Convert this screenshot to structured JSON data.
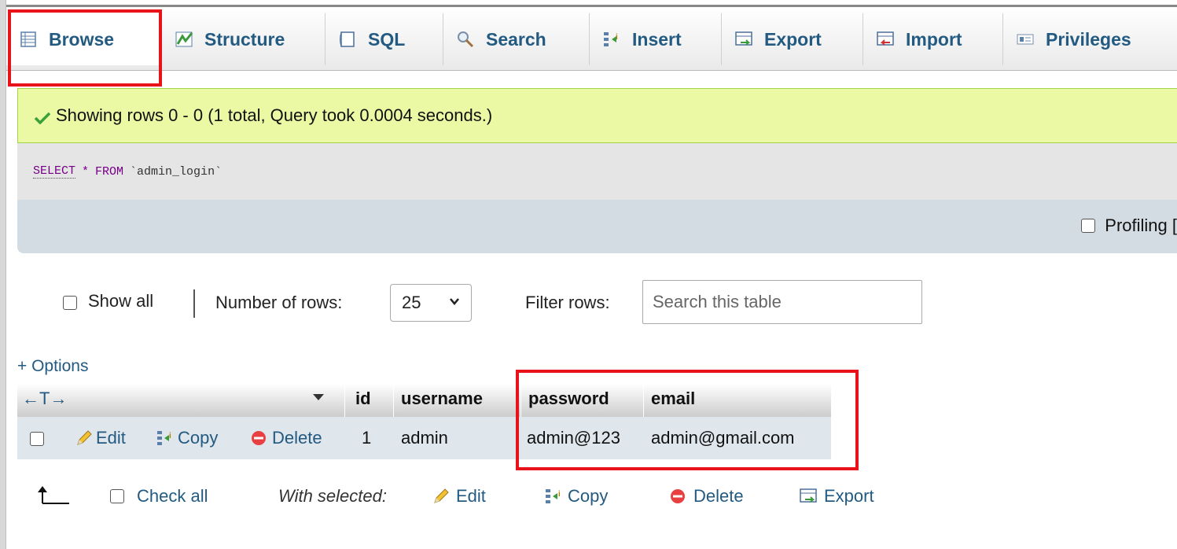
{
  "tabs": [
    {
      "label": "Browse",
      "icon": "browse-icon"
    },
    {
      "label": "Structure",
      "icon": "structure-icon"
    },
    {
      "label": "SQL",
      "icon": "sql-icon"
    },
    {
      "label": "Search",
      "icon": "search-icon"
    },
    {
      "label": "Insert",
      "icon": "insert-icon"
    },
    {
      "label": "Export",
      "icon": "export-icon"
    },
    {
      "label": "Import",
      "icon": "import-icon"
    },
    {
      "label": "Privileges",
      "icon": "privileges-icon"
    }
  ],
  "message": {
    "text": "Showing rows 0 - 0 (1 total, Query took 0.0004 seconds.)"
  },
  "sql": {
    "select": "SELECT",
    "star": "*",
    "from": "FROM",
    "table": "`admin_login`"
  },
  "profiling": {
    "label": "Profiling ["
  },
  "controls": {
    "show_all": "Show all",
    "num_rows_label": "Number of rows:",
    "num_rows_value": "25",
    "filter_label": "Filter rows:",
    "filter_placeholder": "Search this table"
  },
  "options_link": "+ Options",
  "table": {
    "arrows": "←T→",
    "columns": [
      "id",
      "username",
      "password",
      "email"
    ],
    "rows": [
      {
        "id": "1",
        "username": "admin",
        "password": "admin@123",
        "email": "admin@gmail.com"
      }
    ],
    "row_actions": {
      "edit": "Edit",
      "copy": "Copy",
      "delete": "Delete"
    }
  },
  "bottom": {
    "check_all": "Check all",
    "with_selected": "With selected:",
    "edit": "Edit",
    "copy": "Copy",
    "delete": "Delete",
    "export": "Export"
  },
  "colors": {
    "link": "#235a81",
    "highlight": "#e8121a",
    "success_bg": "#ebf8a4"
  }
}
